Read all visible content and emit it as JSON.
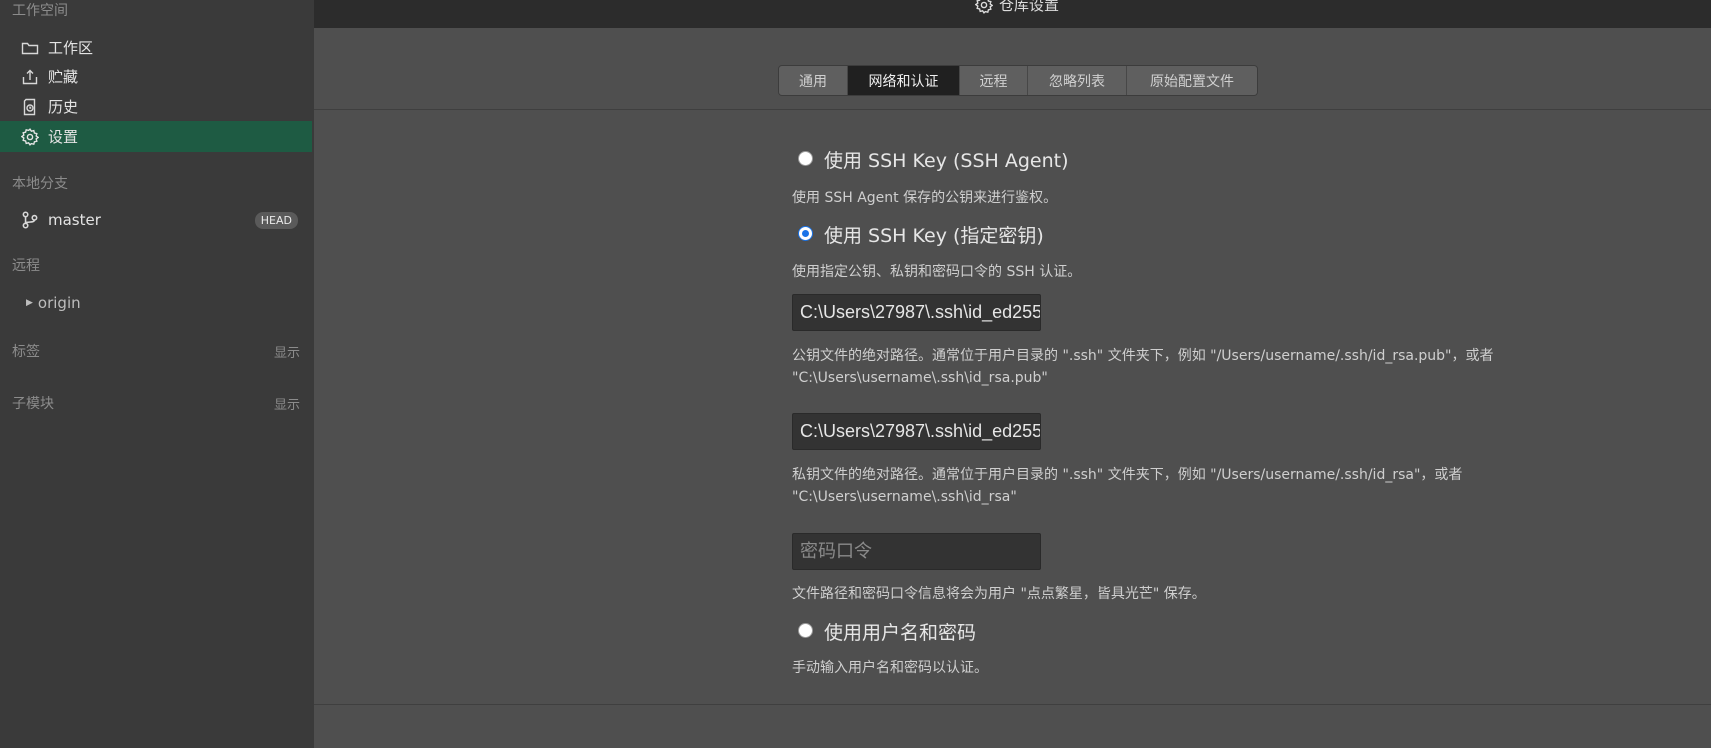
{
  "sidebar": {
    "workspace_title": "工作空间",
    "items": [
      {
        "label": "工作区",
        "icon": "folder-icon"
      },
      {
        "label": "贮藏",
        "icon": "stash-icon"
      },
      {
        "label": "历史",
        "icon": "history-icon"
      },
      {
        "label": "设置",
        "icon": "gear-icon",
        "active": true
      }
    ],
    "local_branches_title": "本地分支",
    "branch": {
      "label": "master",
      "badge": "HEAD",
      "icon": "branch-icon"
    },
    "remotes_title": "远程",
    "remote": {
      "label": "origin"
    },
    "tags_title": "标签",
    "tags_show": "显示",
    "submodules_title": "子模块",
    "submodules_show": "显示"
  },
  "topbar": {
    "title": "仓库设置",
    "icon": "gear-icon"
  },
  "tabs": [
    {
      "label": "通用"
    },
    {
      "label": "网络和认证",
      "active": true
    },
    {
      "label": "远程"
    },
    {
      "label": "忽略列表"
    },
    {
      "label": "原始配置文件"
    }
  ],
  "auth": {
    "ssh_agent": {
      "label": "使用 SSH Key (SSH Agent)",
      "desc": "使用 SSH Agent 保存的公钥来进行鉴权。",
      "checked": false
    },
    "ssh_key": {
      "label": "使用 SSH Key (指定密钥)",
      "desc": "使用指定公钥、私钥和密码口令的 SSH 认证。",
      "checked": true
    },
    "public_key_value": "C:\\Users\\27987\\.ssh\\id_ed255",
    "public_key_help_1": "公钥文件的绝对路径。通常位于用户目录的 \".ssh\" 文件夹下，例如 \"/Users/username/.ssh/id_rsa.pub\"，或者",
    "public_key_help_2": "\"C:\\Users\\username\\.ssh\\id_rsa.pub\"",
    "private_key_value": "C:\\Users\\27987\\.ssh\\id_ed255",
    "private_key_help_1": "私钥文件的绝对路径。通常位于用户目录的 \".ssh\" 文件夹下，例如 \"/Users/username/.ssh/id_rsa\"，或者",
    "private_key_help_2": "\"C:\\Users\\username\\.ssh\\id_rsa\"",
    "passphrase_placeholder": "密码口令",
    "save_note": "文件路径和密码口令信息将会为用户 \"点点繁星，皆具光芒\" 保存。",
    "user_pass": {
      "label": "使用用户名和密码",
      "desc": "手动输入用户名和密码以认证。",
      "checked": false
    }
  }
}
